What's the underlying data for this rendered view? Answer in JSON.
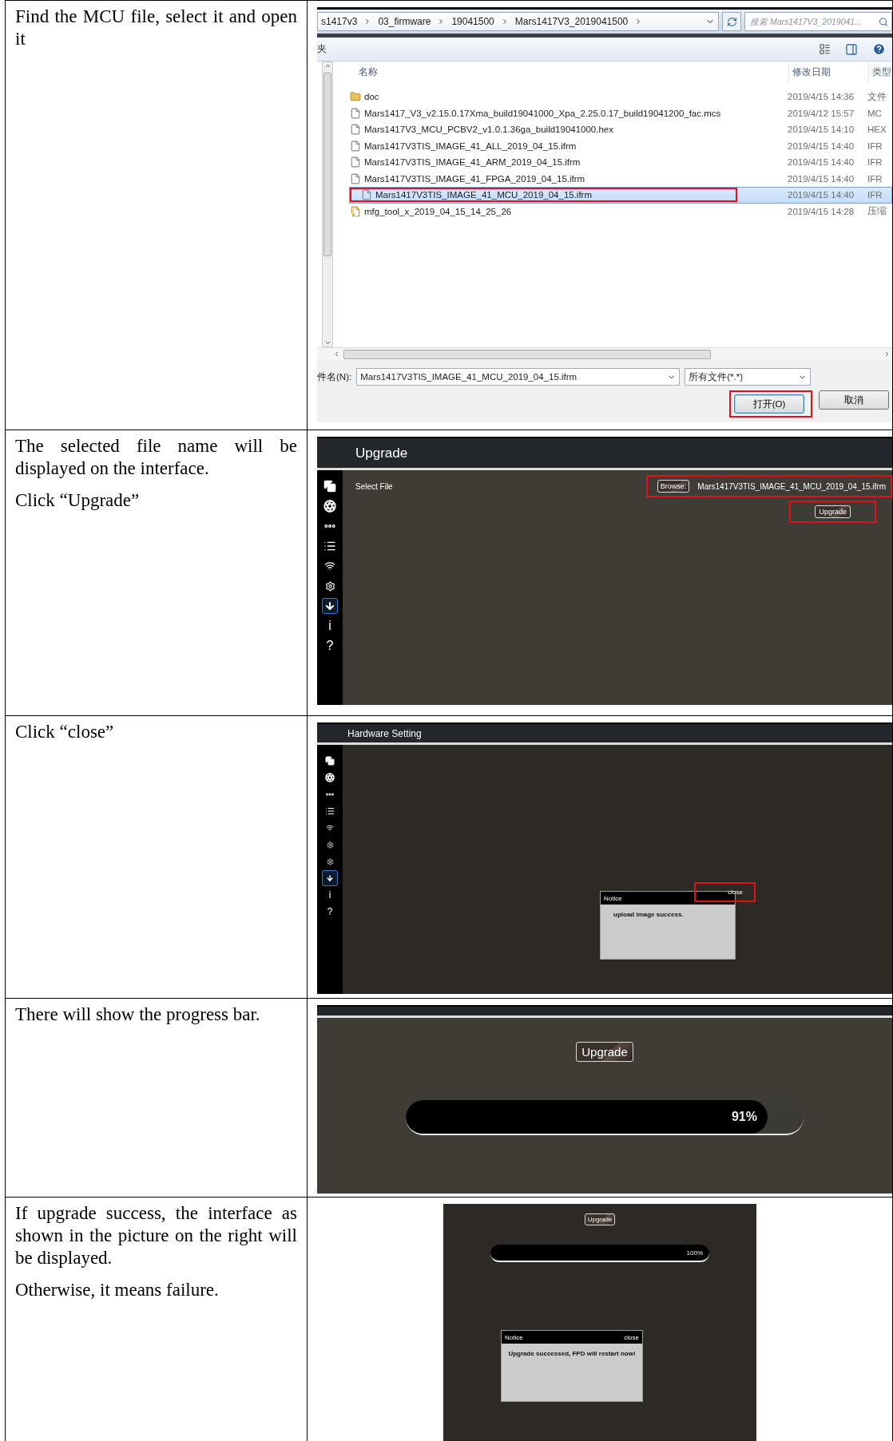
{
  "steps": [
    {
      "kind": "file_dialog",
      "paragraphs": [
        "Find the MCU file, select it and open it"
      ],
      "screen": {
        "breadcrumb": [
          "s1417v3",
          "03_firmware",
          "19041500",
          "Mars1417V3_2019041500"
        ],
        "search": {
          "placeholder": "搜索 Mars1417V3_2019041..."
        },
        "toolbar_label": "夹",
        "columns": [
          "名称",
          "修改日期",
          "类型"
        ],
        "files": [
          {
            "kind": "folder",
            "name": "doc",
            "date": "2019/4/15 14:36",
            "type": "文件",
            "selected": false,
            "highlighted": false
          },
          {
            "kind": "file",
            "name": "Mars1417_V3_v2.15.0.17Xma_build19041000_Xpa_2.25.0.17_build19041200_fac.mcs",
            "date": "2019/4/12 15:57",
            "type": "MC",
            "selected": false,
            "highlighted": false
          },
          {
            "kind": "file",
            "name": "Mars1417V3_MCU_PCBV2_v1.0.1.36ga_build19041000.hex",
            "date": "2019/4/15 14:10",
            "type": "HEX",
            "selected": false,
            "highlighted": false
          },
          {
            "kind": "file",
            "name": "Mars1417V3TIS_IMAGE_41_ALL_2019_04_15.ifrm",
            "date": "2019/4/15 14:40",
            "type": "IFR",
            "selected": false,
            "highlighted": false
          },
          {
            "kind": "file",
            "name": "Mars1417V3TIS_IMAGE_41_ARM_2019_04_15.ifrm",
            "date": "2019/4/15 14:40",
            "type": "IFR",
            "selected": false,
            "highlighted": false
          },
          {
            "kind": "file",
            "name": "Mars1417V3TIS_IMAGE_41_FPGA_2019_04_15.ifrm",
            "date": "2019/4/15 14:40",
            "type": "IFR",
            "selected": false,
            "highlighted": false
          },
          {
            "kind": "file",
            "name": "Mars1417V3TIS_IMAGE_41_MCU_2019_04_15.ifrm",
            "date": "2019/4/15 14:40",
            "type": "IFR",
            "selected": true,
            "highlighted": true
          },
          {
            "kind": "archive",
            "name": "mfg_tool_x_2019_04_15_14_25_26",
            "date": "2019/4/15 14:28",
            "type": "压缩",
            "selected": false,
            "highlighted": false
          }
        ],
        "filename": {
          "label": "件名(N):",
          "value": "Mars1417V3TIS_IMAGE_41_MCU_2019_04_15.ifrm"
        },
        "filetype": "所有文件(*.*)",
        "buttons": [
          {
            "label": "打开(O)",
            "highlighted": true
          },
          {
            "label": "取消",
            "highlighted": false
          }
        ]
      }
    },
    {
      "kind": "upgrade_page",
      "paragraphs": [
        "The selected file name will be displayed on the interface.",
        "Click “Upgrade”"
      ],
      "screen": {
        "title": "Upgrade",
        "sidebar": [
          {
            "kind": "pages",
            "selected": false
          },
          {
            "kind": "aperture",
            "selected": false
          },
          {
            "kind": "dots",
            "selected": false
          },
          {
            "kind": "list",
            "selected": false
          },
          {
            "kind": "wifi",
            "selected": false
          },
          {
            "kind": "gear_wifi",
            "selected": false
          },
          {
            "kind": "download",
            "selected": true
          },
          {
            "kind": "text",
            "text": "i",
            "selected": false
          },
          {
            "kind": "text",
            "text": "?",
            "selected": false
          }
        ],
        "file_label": "Select File",
        "browse": {
          "label": "Browse:",
          "file": "Mars1417V3TIS_IMAGE_41_MCU_2019_04_15.ifrm",
          "highlighted": true
        },
        "upgrade": {
          "label": "Upgrade",
          "highlighted": true
        }
      }
    },
    {
      "kind": "notice_page",
      "paragraphs": [
        "Click “close”"
      ],
      "screen": {
        "title": "Hardware Setting",
        "sidebar": [
          {
            "kind": "pages",
            "selected": false
          },
          {
            "kind": "aperture",
            "selected": false
          },
          {
            "kind": "dots",
            "selected": false
          },
          {
            "kind": "list",
            "selected": false
          },
          {
            "kind": "wifi",
            "selected": false
          },
          {
            "kind": "gear_wifi",
            "selected": false
          },
          {
            "kind": "gear",
            "selected": false
          },
          {
            "kind": "download",
            "selected": true
          },
          {
            "kind": "text",
            "text": "i",
            "selected": false
          },
          {
            "kind": "text",
            "text": "?",
            "selected": false
          }
        ],
        "notice": {
          "title": "Notice",
          "close": "close",
          "close_highlighted": true,
          "message": "upload image success."
        }
      }
    },
    {
      "kind": "progress_page",
      "paragraphs": [
        "There will show the progress bar."
      ],
      "screen": {
        "upgrade": {
          "label": "Upgrade"
        },
        "progress": {
          "level": 0.91,
          "reading": "91%"
        }
      }
    },
    {
      "kind": "result_page",
      "paragraphs": [
        "If upgrade success, the interface as shown in the picture on the right will be displayed.",
        "Otherwise, it means failure."
      ],
      "screen": {
        "upgrade": {
          "label": "Upgrade"
        },
        "progress": {
          "level": 1,
          "reading": "100%"
        },
        "notice": {
          "title": "Notice",
          "close": "close",
          "close_highlighted": false,
          "message": "Upgrade successed, FPD will restart now!"
        }
      }
    }
  ]
}
